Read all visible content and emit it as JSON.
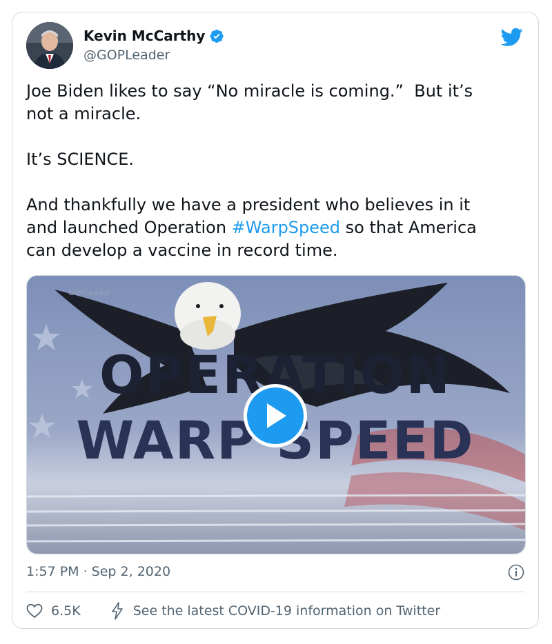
{
  "tweet": {
    "author_name": "Kevin McCarthy",
    "author_handle": "@GOPLeader",
    "text_part1": "Joe Biden likes to say “No miracle is coming.”  But it’s\nnot a miracle.\n\nIt’s SCIENCE.\n\nAnd thankfully we have a president who believes in it\nand launched Operation ",
    "hashtag": "#WarpSpeed",
    "text_part2": " so that America\ncan develop a vaccine in record time.",
    "timestamp": "1:57 PM · Sep 2, 2020",
    "like_count": "6.5K",
    "covid_link": "See the latest COVID-19 information on Twitter"
  },
  "video": {
    "line1": "OPERATION",
    "line2": "WARP SPEED",
    "watermark": "GOPLeader"
  },
  "colors": {
    "accent": "#1d9bf0",
    "secondary_text": "#536471",
    "border": "#cfd9de"
  },
  "icons": [
    "verified-badge-icon",
    "twitter-bird-icon",
    "play-icon",
    "info-icon",
    "heart-icon",
    "bolt-icon"
  ]
}
